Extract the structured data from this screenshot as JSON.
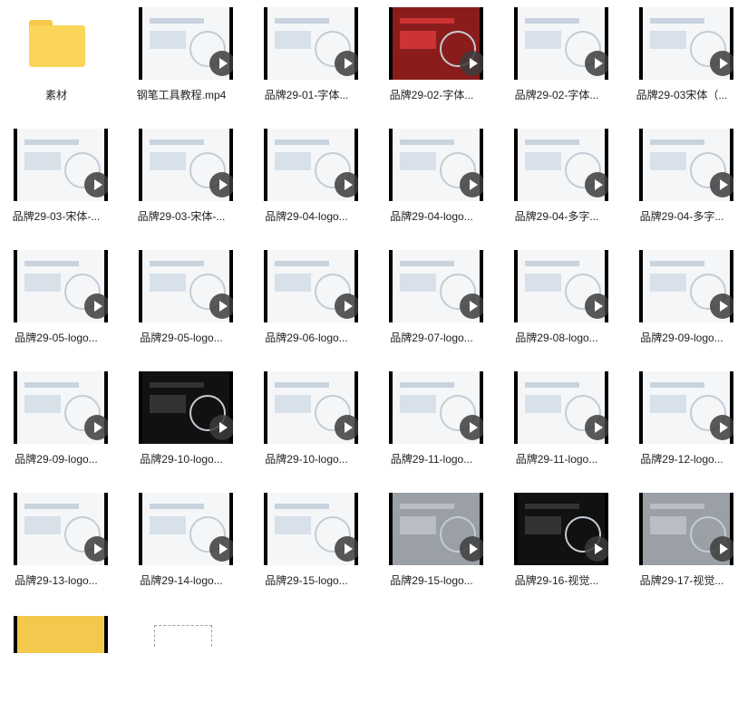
{
  "colors": {
    "folder": "#fbd45a",
    "play_button": "#3c3c3c",
    "label_text": "#222222"
  },
  "files": [
    {
      "name": "素材",
      "type": "folder"
    },
    {
      "name": "钢笔工具教程.mp4",
      "type": "video",
      "theme": "light"
    },
    {
      "name": "品牌29-01-字体...",
      "type": "video",
      "theme": "light"
    },
    {
      "name": "品牌29-02-字体...",
      "type": "video",
      "theme": "red"
    },
    {
      "name": "品牌29-02-字体...",
      "type": "video",
      "theme": "light"
    },
    {
      "name": "品牌29-03宋体（...",
      "type": "video",
      "theme": "light"
    },
    {
      "name": "品牌29-03-宋体-...",
      "type": "video",
      "theme": "light"
    },
    {
      "name": "品牌29-03-宋体-...",
      "type": "video",
      "theme": "light"
    },
    {
      "name": "品牌29-04-logo...",
      "type": "video",
      "theme": "light"
    },
    {
      "name": "品牌29-04-logo...",
      "type": "video",
      "theme": "light"
    },
    {
      "name": "品牌29-04-多字...",
      "type": "video",
      "theme": "light"
    },
    {
      "name": "品牌29-04-多字...",
      "type": "video",
      "theme": "light"
    },
    {
      "name": "品牌29-05-logo...",
      "type": "video",
      "theme": "light"
    },
    {
      "name": "品牌29-05-logo...",
      "type": "video",
      "theme": "light"
    },
    {
      "name": "品牌29-06-logo...",
      "type": "video",
      "theme": "light"
    },
    {
      "name": "品牌29-07-logo...",
      "type": "video",
      "theme": "light"
    },
    {
      "name": "品牌29-08-logo...",
      "type": "video",
      "theme": "light"
    },
    {
      "name": "品牌29-09-logo...",
      "type": "video",
      "theme": "light"
    },
    {
      "name": "品牌29-09-logo...",
      "type": "video",
      "theme": "light"
    },
    {
      "name": "品牌29-10-logo...",
      "type": "video",
      "theme": "dark"
    },
    {
      "name": "品牌29-10-logo...",
      "type": "video",
      "theme": "light"
    },
    {
      "name": "品牌29-11-logo...",
      "type": "video",
      "theme": "light"
    },
    {
      "name": "品牌29-11-logo...",
      "type": "video",
      "theme": "light"
    },
    {
      "name": "品牌29-12-logo...",
      "type": "video",
      "theme": "light"
    },
    {
      "name": "品牌29-13-logo...",
      "type": "video",
      "theme": "light"
    },
    {
      "name": "品牌29-14-logo...",
      "type": "video",
      "theme": "light"
    },
    {
      "name": "品牌29-15-logo...",
      "type": "video",
      "theme": "light"
    },
    {
      "name": "品牌29-15-logo...",
      "type": "video",
      "theme": "grey"
    },
    {
      "name": "品牌29-16-视觉...",
      "type": "video",
      "theme": "dark"
    },
    {
      "name": "品牌29-17-视觉...",
      "type": "video",
      "theme": "grey"
    }
  ]
}
